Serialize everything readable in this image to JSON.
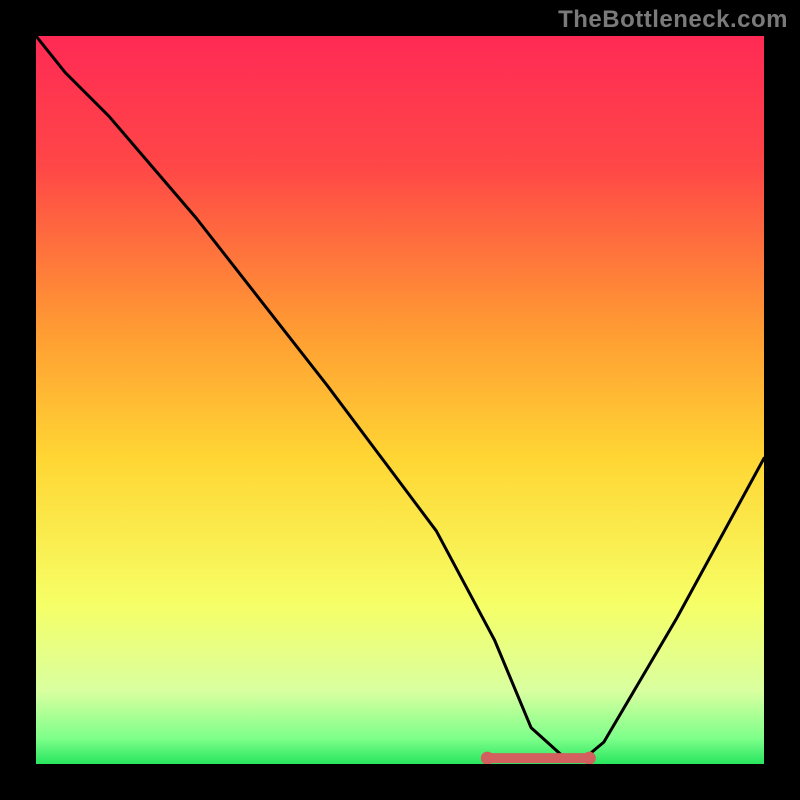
{
  "watermark": "TheBottleneck.com",
  "colors": {
    "bg_black": "#000000",
    "curve": "#000000",
    "band_color": "#d1605e",
    "grad_top": "#ff2a55",
    "grad_mid_upper": "#ff6a3a",
    "grad_mid": "#ffd633",
    "grad_mid_lower": "#f6ff66",
    "grad_lower": "#d9ffa0",
    "grad_bottom": "#28e65e"
  },
  "chart_data": {
    "type": "line",
    "title": "",
    "xlabel": "",
    "ylabel": "",
    "xlim": [
      0,
      100
    ],
    "ylim": [
      0,
      100
    ],
    "curve": {
      "name": "bottleneck-curve",
      "x": [
        0,
        4,
        10,
        22,
        40,
        55,
        63,
        68,
        73,
        75,
        78,
        88,
        100
      ],
      "y": [
        100,
        95,
        89,
        75,
        52,
        32,
        17,
        5,
        0.5,
        0.5,
        3,
        20,
        42
      ]
    },
    "optimal_band": {
      "x_start": 62,
      "x_end": 76,
      "y": 0.8,
      "thickness": 1.6
    },
    "gradient_stops": [
      {
        "offset": 0.0,
        "color": "#ff2a55"
      },
      {
        "offset": 0.18,
        "color": "#ff4747"
      },
      {
        "offset": 0.4,
        "color": "#ff9a33"
      },
      {
        "offset": 0.58,
        "color": "#ffd633"
      },
      {
        "offset": 0.78,
        "color": "#f6ff66"
      },
      {
        "offset": 0.9,
        "color": "#d9ffa0"
      },
      {
        "offset": 0.965,
        "color": "#7dff8a"
      },
      {
        "offset": 1.0,
        "color": "#28e65e"
      }
    ]
  }
}
